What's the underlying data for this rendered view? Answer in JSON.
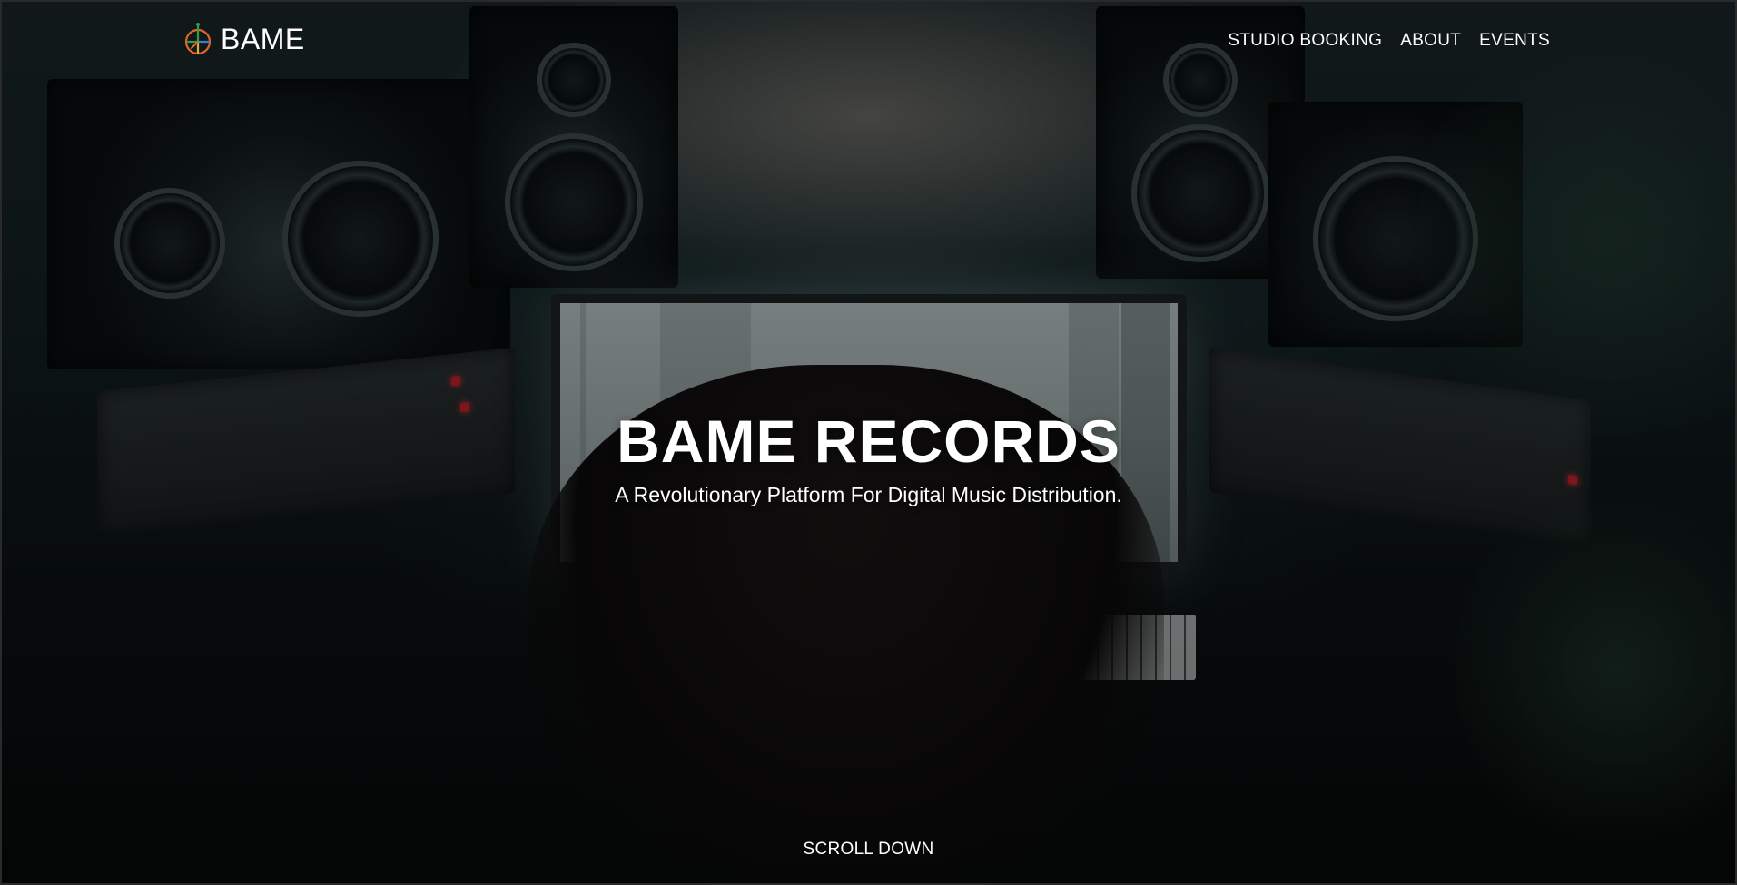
{
  "brand": {
    "logo_icon": "bame-compass-logo-icon",
    "name": "BAME",
    "logo_colors": [
      "#2e9e4b",
      "#e0662a",
      "#3a7bd5",
      "#d9b13a"
    ]
  },
  "nav": {
    "items": [
      {
        "label": "STUDIO BOOKING"
      },
      {
        "label": "ABOUT"
      },
      {
        "label": "EVENTS"
      }
    ]
  },
  "hero": {
    "background": "recording-studio-photo",
    "title": "BAME RECORDS",
    "subtitle": "A Revolutionary Platform For Digital Music Distribution.",
    "scroll_label": "SCROLL DOWN"
  },
  "colors": {
    "text": "#ffffff",
    "overlay": "#000000"
  }
}
